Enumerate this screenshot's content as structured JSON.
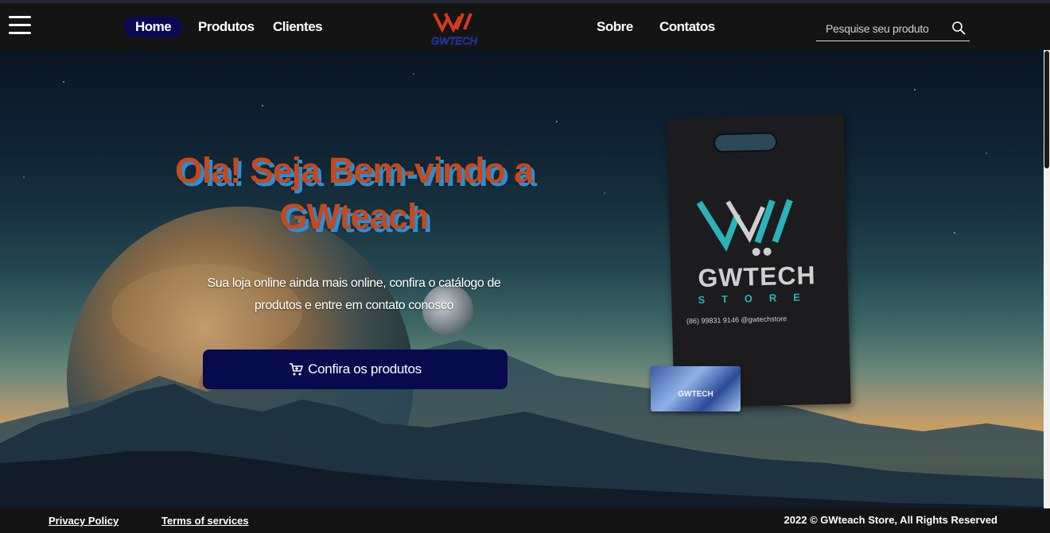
{
  "nav": {
    "menu_icon": "hamburger-icon",
    "links": [
      {
        "label": "Home",
        "active": true
      },
      {
        "label": "Produtos",
        "active": false
      },
      {
        "label": "Clientes",
        "active": false
      },
      {
        "label": "Sobre",
        "active": false
      },
      {
        "label": "Contatos",
        "active": false
      }
    ],
    "logo_text": "GWTECH",
    "search": {
      "placeholder": "Pesquise seu produto",
      "value": "",
      "icon": "search-icon"
    }
  },
  "hero": {
    "headline": "Ola! Seja Bem-vindo a GWteach",
    "subtext": "Sua loja online ainda mais online, confira o catálogo de produtos e entre em contato conosco",
    "cta_label": "Confira os produtos",
    "cta_icon": "cart-icon",
    "bag": {
      "brand": "GWTECH",
      "sub": "STORE",
      "contact": "(86) 99831 9146  @gwtechstore"
    },
    "card_text": "GWTECH"
  },
  "footer": {
    "privacy": "Privacy Policy",
    "terms": "Terms of services",
    "copyright": "2022 © GWteach Store, All Rights Reserved"
  },
  "colors": {
    "bar_bg": "#141414",
    "active_pill": "#0a0a54",
    "cta_bg": "#070a4d",
    "headline": "#c24a1f",
    "headline_shadow": "#2a8fd6",
    "brand_teal": "#2bb3b8",
    "logo_red": "#d63a1e"
  }
}
